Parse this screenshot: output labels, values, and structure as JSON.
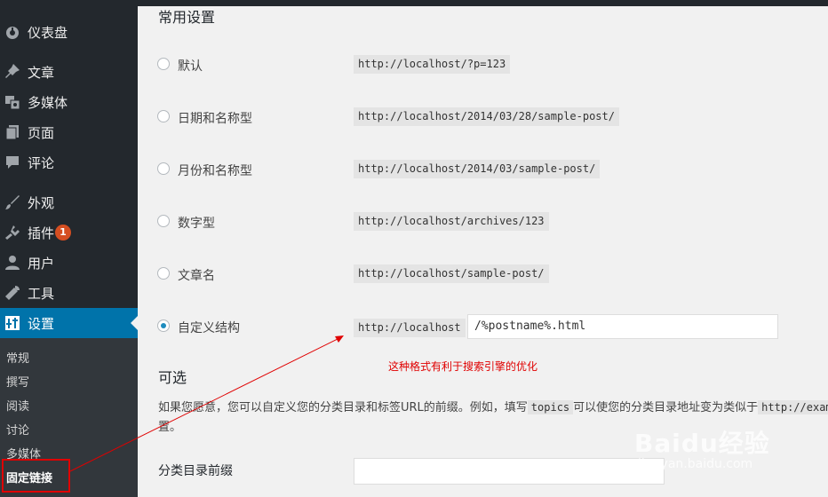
{
  "sidebar": {
    "items": [
      {
        "label": "仪表盘",
        "icon": "dashboard-icon"
      },
      {
        "label": "文章",
        "icon": "pin-icon"
      },
      {
        "label": "多媒体",
        "icon": "media-icon"
      },
      {
        "label": "页面",
        "icon": "pages-icon"
      },
      {
        "label": "评论",
        "icon": "comment-icon"
      },
      {
        "label": "外观",
        "icon": "brush-icon"
      },
      {
        "label": "插件",
        "icon": "plugin-icon",
        "badge": "1"
      },
      {
        "label": "用户",
        "icon": "user-icon"
      },
      {
        "label": "工具",
        "icon": "wrench-icon"
      },
      {
        "label": "设置",
        "icon": "settings-icon"
      }
    ],
    "submenu": [
      "常规",
      "撰写",
      "阅读",
      "讨论",
      "多媒体",
      "固定链接"
    ]
  },
  "main": {
    "heading": "常用设置",
    "options": [
      {
        "label": "默认",
        "example": "http://localhost/?p=123",
        "checked": false
      },
      {
        "label": "日期和名称型",
        "example": "http://localhost/2014/03/28/sample-post/",
        "checked": false
      },
      {
        "label": "月份和名称型",
        "example": "http://localhost/2014/03/sample-post/",
        "checked": false
      },
      {
        "label": "数字型",
        "example": "http://localhost/archives/123",
        "checked": false
      },
      {
        "label": "文章名",
        "example": "http://localhost/sample-post/",
        "checked": false
      },
      {
        "label": "自定义结构",
        "example": "http://localhost",
        "checked": true
      }
    ],
    "custom_structure_value": "/%postname%.html",
    "annotation": "这种格式有利于搜索引擎的优化",
    "optional_title": "可选",
    "optional_desc_part1": "如果您愿意，您可以自定义您的分类目录和标签URL的前缀。例如，填写",
    "optional_desc_code1": "topics",
    "optional_desc_part2": "可以使您的分类目录地址变为类似于",
    "optional_desc_code2": "http://exam",
    "optional_desc_tail": "置。",
    "category_base_label": "分类目录前缀",
    "category_base_value": ""
  },
  "watermark": {
    "logo": "Baidu经验",
    "url": "jingyan.baidu.com"
  },
  "colors": {
    "sidebar": "#23282d",
    "active": "#0073aa",
    "badge": "#d54e21",
    "annotation": "#e00000"
  }
}
